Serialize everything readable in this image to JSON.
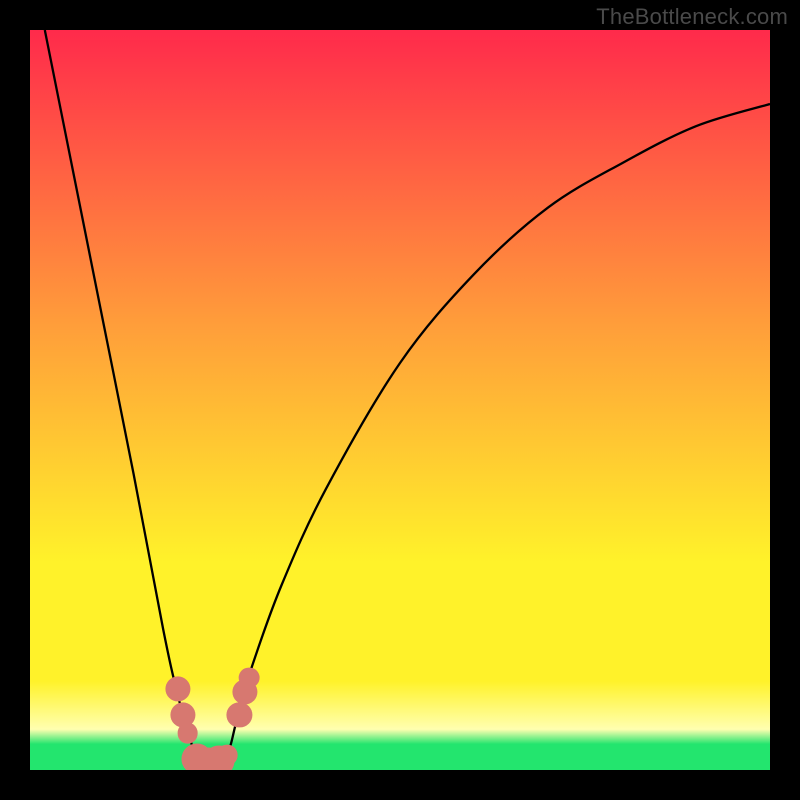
{
  "watermark": "TheBottleneck.com",
  "colors": {
    "red": "#ff2a4b",
    "orange": "#ff9e3a",
    "yellow": "#fff22a",
    "pale": "#ffffb0",
    "green": "#23e56e",
    "curve": "#000000",
    "bead": "#d77870"
  },
  "chart_data": {
    "type": "line",
    "title": "",
    "xlabel": "",
    "ylabel": "",
    "xlim": [
      0,
      100
    ],
    "ylim": [
      0,
      100
    ],
    "note": "Bottleneck-style curve: y ~ 0 near optimum x≈24, rising steeply on both sides; x is relative component strength, y is bottleneck %",
    "x": [
      2,
      6,
      10,
      14,
      18,
      20,
      22,
      23,
      24,
      25,
      26,
      27,
      28,
      30,
      34,
      40,
      50,
      60,
      70,
      80,
      90,
      100
    ],
    "y": [
      100,
      80,
      60,
      40,
      19,
      10,
      3,
      1,
      0.5,
      0.5,
      1,
      3,
      7,
      14,
      25,
      38,
      55,
      67,
      76,
      82,
      87,
      90
    ],
    "optimum_x": 24,
    "beads": [
      {
        "x": 20.0,
        "y": 11.0,
        "r": 1.7
      },
      {
        "x": 20.7,
        "y": 7.5,
        "r": 1.7
      },
      {
        "x": 21.3,
        "y": 5.0,
        "r": 1.4
      },
      {
        "x": 22.5,
        "y": 1.5,
        "r": 2.1
      },
      {
        "x": 24.0,
        "y": 1.0,
        "r": 2.1
      },
      {
        "x": 25.5,
        "y": 1.2,
        "r": 2.1
      },
      {
        "x": 26.6,
        "y": 2.0,
        "r": 1.4
      },
      {
        "x": 28.3,
        "y": 7.5,
        "r": 1.7
      },
      {
        "x": 29.0,
        "y": 10.5,
        "r": 1.7
      },
      {
        "x": 29.6,
        "y": 12.5,
        "r": 1.4
      }
    ]
  }
}
